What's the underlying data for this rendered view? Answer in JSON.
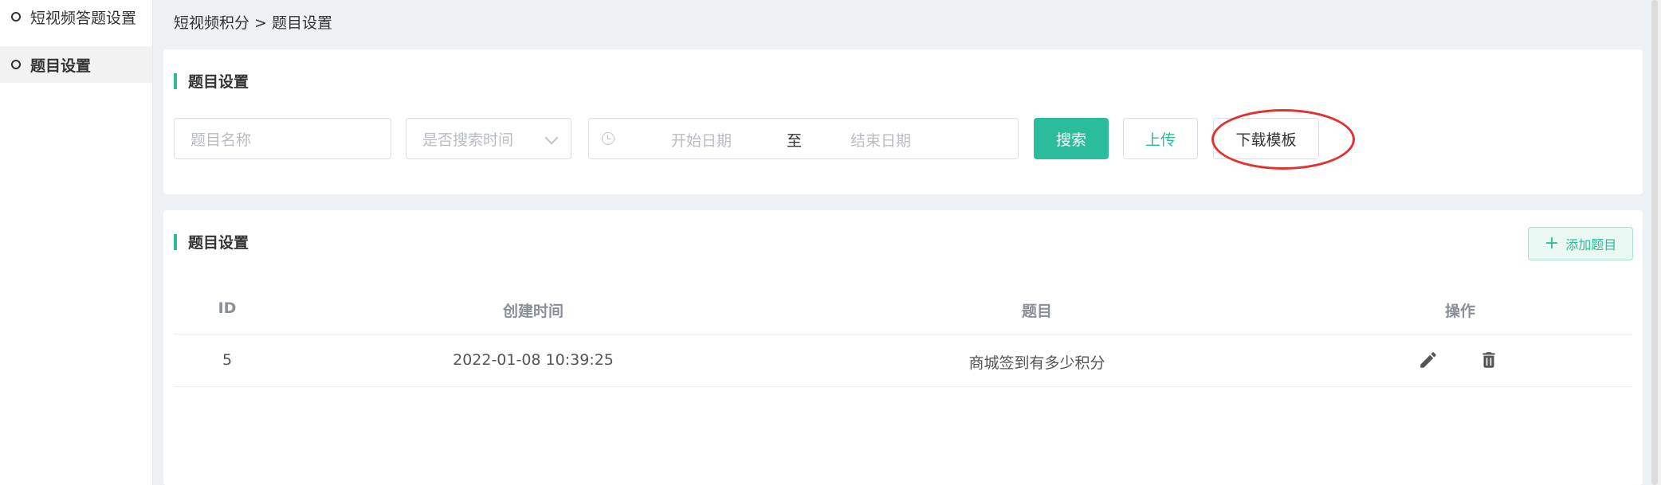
{
  "sidebar": {
    "items": [
      {
        "label": "短视频答题设置"
      },
      {
        "label": "题目设置"
      }
    ]
  },
  "breadcrumb": "短视频积分 > 题目设置",
  "filter_section": {
    "title": "题目设置",
    "name_placeholder": "题目名称",
    "select_placeholder": "是否搜索时间",
    "start_date_placeholder": "开始日期",
    "date_separator": "至",
    "end_date_placeholder": "结束日期",
    "search_label": "搜索",
    "upload_label": "上传",
    "download_label": "下载模板"
  },
  "list_section": {
    "title": "题目设置",
    "add_label": "添加题目",
    "columns": [
      "ID",
      "创建时间",
      "题目",
      "操作"
    ],
    "rows": [
      {
        "id": "5",
        "created": "2022-01-08 10:39:25",
        "question": "商城签到有多少积分"
      }
    ]
  },
  "colors": {
    "accent": "#2bbd9b",
    "highlight_circle": "#e2312f"
  },
  "icons": [
    "clock-icon",
    "chevron-down-icon",
    "plus-icon",
    "edit-icon",
    "delete-icon"
  ]
}
